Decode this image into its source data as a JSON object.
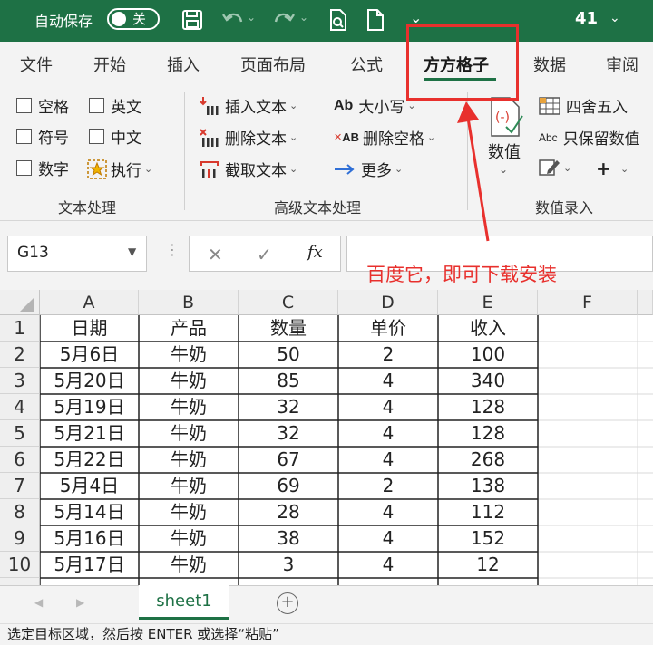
{
  "titlebar": {
    "autosave_label": "自动保存",
    "autosave_state": "关",
    "file_name": "41",
    "dropdown_glyph": "⌄",
    "bg_color": "#1e7145"
  },
  "tabs": [
    {
      "label": "文件"
    },
    {
      "label": "开始"
    },
    {
      "label": "插入"
    },
    {
      "label": "页面布局"
    },
    {
      "label": "公式"
    },
    {
      "label": "方方格子",
      "active": true
    },
    {
      "label": "数据"
    },
    {
      "label": "审阅"
    }
  ],
  "ribbon": {
    "text_group": {
      "checkboxes": [
        "空格",
        "英文",
        "符号",
        "中文",
        "数字"
      ],
      "execute_label": "执行",
      "group_label": "文本处理"
    },
    "advanced_group": {
      "insert_text": "插入文本",
      "delete_text": "删除文本",
      "extract_text": "截取文本",
      "case_label": "大小写",
      "delete_spaces": "删除空格",
      "more_label": "更多",
      "case_icon_text": "Ab",
      "delete_spaces_icon_text": "AB",
      "group_label": "高级文本处理"
    },
    "number_group": {
      "value_label": "数值",
      "round_label": "四舍五入",
      "keep_values_label": "只保留数值",
      "keep_values_icon_text": "Abc",
      "group_label": "数值录入",
      "plus_label": "+"
    }
  },
  "annotation": {
    "text": "百度它，即可下载安装",
    "color": "#e8302d"
  },
  "formula_bar": {
    "name_box": "G13",
    "fx_label": "fx",
    "formula": ""
  },
  "sheet": {
    "columns": [
      "A",
      "B",
      "C",
      "D",
      "E",
      "F"
    ],
    "rows": [
      {
        "n": "1",
        "cells": [
          "日期",
          "产品",
          "数量",
          "单价",
          "收入"
        ]
      },
      {
        "n": "2",
        "cells": [
          "5月6日",
          "牛奶",
          "50",
          "2",
          "100"
        ]
      },
      {
        "n": "3",
        "cells": [
          "5月20日",
          "牛奶",
          "85",
          "4",
          "340"
        ]
      },
      {
        "n": "4",
        "cells": [
          "5月19日",
          "牛奶",
          "32",
          "4",
          "128"
        ]
      },
      {
        "n": "5",
        "cells": [
          "5月21日",
          "牛奶",
          "32",
          "4",
          "128"
        ]
      },
      {
        "n": "6",
        "cells": [
          "5月22日",
          "牛奶",
          "67",
          "4",
          "268"
        ]
      },
      {
        "n": "7",
        "cells": [
          "5月4日",
          "牛奶",
          "69",
          "2",
          "138"
        ]
      },
      {
        "n": "8",
        "cells": [
          "5月14日",
          "牛奶",
          "28",
          "4",
          "112"
        ]
      },
      {
        "n": "9",
        "cells": [
          "5月16日",
          "牛奶",
          "38",
          "4",
          "152"
        ]
      },
      {
        "n": "10",
        "cells": [
          "5月17日",
          "牛奶",
          "3",
          "4",
          "12"
        ]
      }
    ]
  },
  "sheet_tabs": {
    "active": "sheet1",
    "add_label": "+",
    "prev_label": "◀",
    "next_label": "▶"
  },
  "status_bar": {
    "text": "选定目标区域，然后按 ENTER 或选择“粘贴”"
  }
}
